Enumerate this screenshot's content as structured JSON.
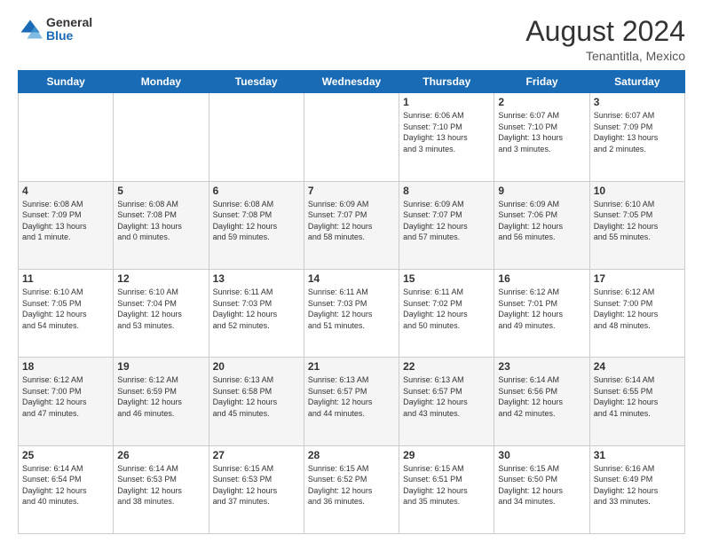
{
  "header": {
    "logo_line1": "General",
    "logo_line2": "Blue",
    "month_year": "August 2024",
    "location": "Tenantitla, Mexico"
  },
  "days_of_week": [
    "Sunday",
    "Monday",
    "Tuesday",
    "Wednesday",
    "Thursday",
    "Friday",
    "Saturday"
  ],
  "weeks": [
    [
      {
        "day": "",
        "info": ""
      },
      {
        "day": "",
        "info": ""
      },
      {
        "day": "",
        "info": ""
      },
      {
        "day": "",
        "info": ""
      },
      {
        "day": "1",
        "info": "Sunrise: 6:06 AM\nSunset: 7:10 PM\nDaylight: 13 hours\nand 3 minutes."
      },
      {
        "day": "2",
        "info": "Sunrise: 6:07 AM\nSunset: 7:10 PM\nDaylight: 13 hours\nand 3 minutes."
      },
      {
        "day": "3",
        "info": "Sunrise: 6:07 AM\nSunset: 7:09 PM\nDaylight: 13 hours\nand 2 minutes."
      }
    ],
    [
      {
        "day": "4",
        "info": "Sunrise: 6:08 AM\nSunset: 7:09 PM\nDaylight: 13 hours\nand 1 minute."
      },
      {
        "day": "5",
        "info": "Sunrise: 6:08 AM\nSunset: 7:08 PM\nDaylight: 13 hours\nand 0 minutes."
      },
      {
        "day": "6",
        "info": "Sunrise: 6:08 AM\nSunset: 7:08 PM\nDaylight: 12 hours\nand 59 minutes."
      },
      {
        "day": "7",
        "info": "Sunrise: 6:09 AM\nSunset: 7:07 PM\nDaylight: 12 hours\nand 58 minutes."
      },
      {
        "day": "8",
        "info": "Sunrise: 6:09 AM\nSunset: 7:07 PM\nDaylight: 12 hours\nand 57 minutes."
      },
      {
        "day": "9",
        "info": "Sunrise: 6:09 AM\nSunset: 7:06 PM\nDaylight: 12 hours\nand 56 minutes."
      },
      {
        "day": "10",
        "info": "Sunrise: 6:10 AM\nSunset: 7:05 PM\nDaylight: 12 hours\nand 55 minutes."
      }
    ],
    [
      {
        "day": "11",
        "info": "Sunrise: 6:10 AM\nSunset: 7:05 PM\nDaylight: 12 hours\nand 54 minutes."
      },
      {
        "day": "12",
        "info": "Sunrise: 6:10 AM\nSunset: 7:04 PM\nDaylight: 12 hours\nand 53 minutes."
      },
      {
        "day": "13",
        "info": "Sunrise: 6:11 AM\nSunset: 7:03 PM\nDaylight: 12 hours\nand 52 minutes."
      },
      {
        "day": "14",
        "info": "Sunrise: 6:11 AM\nSunset: 7:03 PM\nDaylight: 12 hours\nand 51 minutes."
      },
      {
        "day": "15",
        "info": "Sunrise: 6:11 AM\nSunset: 7:02 PM\nDaylight: 12 hours\nand 50 minutes."
      },
      {
        "day": "16",
        "info": "Sunrise: 6:12 AM\nSunset: 7:01 PM\nDaylight: 12 hours\nand 49 minutes."
      },
      {
        "day": "17",
        "info": "Sunrise: 6:12 AM\nSunset: 7:00 PM\nDaylight: 12 hours\nand 48 minutes."
      }
    ],
    [
      {
        "day": "18",
        "info": "Sunrise: 6:12 AM\nSunset: 7:00 PM\nDaylight: 12 hours\nand 47 minutes."
      },
      {
        "day": "19",
        "info": "Sunrise: 6:12 AM\nSunset: 6:59 PM\nDaylight: 12 hours\nand 46 minutes."
      },
      {
        "day": "20",
        "info": "Sunrise: 6:13 AM\nSunset: 6:58 PM\nDaylight: 12 hours\nand 45 minutes."
      },
      {
        "day": "21",
        "info": "Sunrise: 6:13 AM\nSunset: 6:57 PM\nDaylight: 12 hours\nand 44 minutes."
      },
      {
        "day": "22",
        "info": "Sunrise: 6:13 AM\nSunset: 6:57 PM\nDaylight: 12 hours\nand 43 minutes."
      },
      {
        "day": "23",
        "info": "Sunrise: 6:14 AM\nSunset: 6:56 PM\nDaylight: 12 hours\nand 42 minutes."
      },
      {
        "day": "24",
        "info": "Sunrise: 6:14 AM\nSunset: 6:55 PM\nDaylight: 12 hours\nand 41 minutes."
      }
    ],
    [
      {
        "day": "25",
        "info": "Sunrise: 6:14 AM\nSunset: 6:54 PM\nDaylight: 12 hours\nand 40 minutes."
      },
      {
        "day": "26",
        "info": "Sunrise: 6:14 AM\nSunset: 6:53 PM\nDaylight: 12 hours\nand 38 minutes."
      },
      {
        "day": "27",
        "info": "Sunrise: 6:15 AM\nSunset: 6:53 PM\nDaylight: 12 hours\nand 37 minutes."
      },
      {
        "day": "28",
        "info": "Sunrise: 6:15 AM\nSunset: 6:52 PM\nDaylight: 12 hours\nand 36 minutes."
      },
      {
        "day": "29",
        "info": "Sunrise: 6:15 AM\nSunset: 6:51 PM\nDaylight: 12 hours\nand 35 minutes."
      },
      {
        "day": "30",
        "info": "Sunrise: 6:15 AM\nSunset: 6:50 PM\nDaylight: 12 hours\nand 34 minutes."
      },
      {
        "day": "31",
        "info": "Sunrise: 6:16 AM\nSunset: 6:49 PM\nDaylight: 12 hours\nand 33 minutes."
      }
    ]
  ]
}
